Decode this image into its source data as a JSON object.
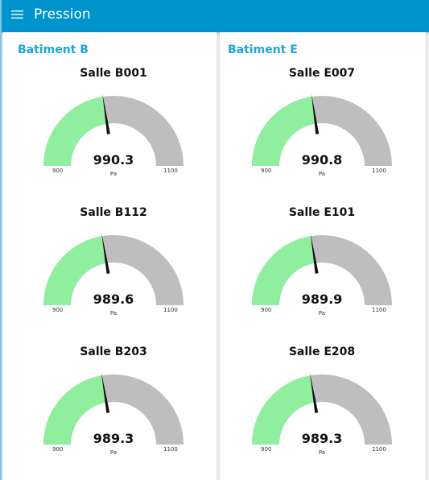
{
  "header": {
    "title": "Pression",
    "menu_icon": "hamburger-menu-icon",
    "color": "#0094ce"
  },
  "colors": {
    "gauge_fill": "#90ee9f",
    "gauge_track": "#bebebe",
    "needle": "#111111",
    "group_title": "#1ea5d9"
  },
  "groups": [
    {
      "title": "Batiment B",
      "gauges": [
        {
          "label": "Salle B001",
          "value": 990.3,
          "value_text": "990.3",
          "unit": "Pa",
          "min": 900,
          "max": 1100,
          "min_text": "900",
          "max_text": "1100"
        },
        {
          "label": "Salle B112",
          "value": 989.6,
          "value_text": "989.6",
          "unit": "Pa",
          "min": 900,
          "max": 1100,
          "min_text": "900",
          "max_text": "1100"
        },
        {
          "label": "Salle B203",
          "value": 989.3,
          "value_text": "989.3",
          "unit": "Pa",
          "min": 900,
          "max": 1100,
          "min_text": "900",
          "max_text": "1100"
        }
      ]
    },
    {
      "title": "Batiment E",
      "gauges": [
        {
          "label": "Salle E007",
          "value": 990.8,
          "value_text": "990.8",
          "unit": "Pa",
          "min": 900,
          "max": 1100,
          "min_text": "900",
          "max_text": "1100"
        },
        {
          "label": "Salle E101",
          "value": 989.9,
          "value_text": "989.9",
          "unit": "Pa",
          "min": 900,
          "max": 1100,
          "min_text": "900",
          "max_text": "1100"
        },
        {
          "label": "Salle E208",
          "value": 989.3,
          "value_text": "989.3",
          "unit": "Pa",
          "min": 900,
          "max": 1100,
          "min_text": "900",
          "max_text": "1100"
        }
      ]
    }
  ]
}
